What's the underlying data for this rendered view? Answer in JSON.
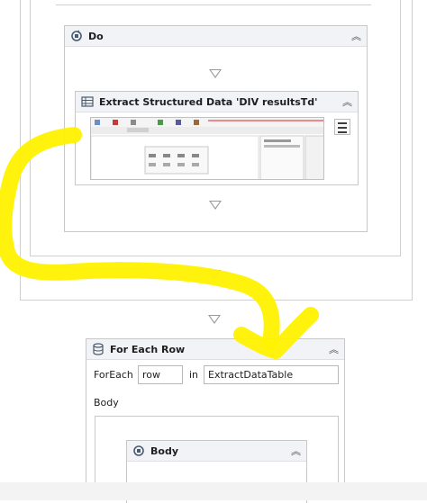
{
  "do_activity": {
    "title": "Do",
    "collapse_glyph": "︽"
  },
  "extract_activity": {
    "title": "Extract Structured Data 'DIV  resultsTd'",
    "collapse_glyph": "︽"
  },
  "foreach_activity": {
    "title": "For Each Row",
    "collapse_glyph": "︽",
    "foreach_label": "ForEach",
    "item_value": "row",
    "in_label": "in",
    "collection_value": "ExtractDataTable",
    "body_label": "Body"
  },
  "body_activity": {
    "title": "Body",
    "collapse_glyph": "︽"
  },
  "colors": {
    "highlighter": "#fff200",
    "header_bg": "#f1f3f6",
    "border": "#c8c8c8"
  }
}
